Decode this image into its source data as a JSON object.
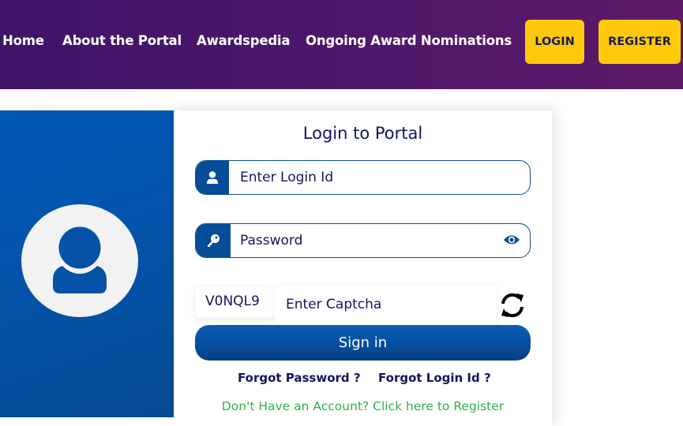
{
  "header": {
    "nav": [
      {
        "label": "Home"
      },
      {
        "label": "About the Portal"
      },
      {
        "label": "Awardspedia"
      },
      {
        "label": "Ongoing Award Nominations"
      }
    ],
    "login_button": "LOGIN",
    "register_button": "REGISTER",
    "colors": {
      "background_start": "#3f1467",
      "background_end": "#5e1a68",
      "button": "#ffc90b",
      "button_text": "#1b1b55"
    }
  },
  "side_panel": {
    "avatar_icon": "user-avatar-icon",
    "color": "#0452a6"
  },
  "login_form": {
    "title": "Login to Portal",
    "login_id": {
      "value": "",
      "placeholder": "Enter Login Id",
      "icon": "user-icon"
    },
    "password": {
      "value": "",
      "placeholder": "Password",
      "icon": "key-icon",
      "toggle_icon": "eye-icon"
    },
    "captcha": {
      "code": "V0NQL9",
      "value": "",
      "placeholder": "Enter Captcha",
      "refresh_icon": "refresh-icon"
    },
    "sign_in_button": "Sign in",
    "forgot_password": "Forgot Password ?",
    "forgot_login_id": "Forgot Login Id ?",
    "register_prompt": "Don't Have an Account? Click here to Register",
    "colors": {
      "primary": "#074c97",
      "text": "#14135e",
      "register_link": "#2fb14a"
    }
  }
}
